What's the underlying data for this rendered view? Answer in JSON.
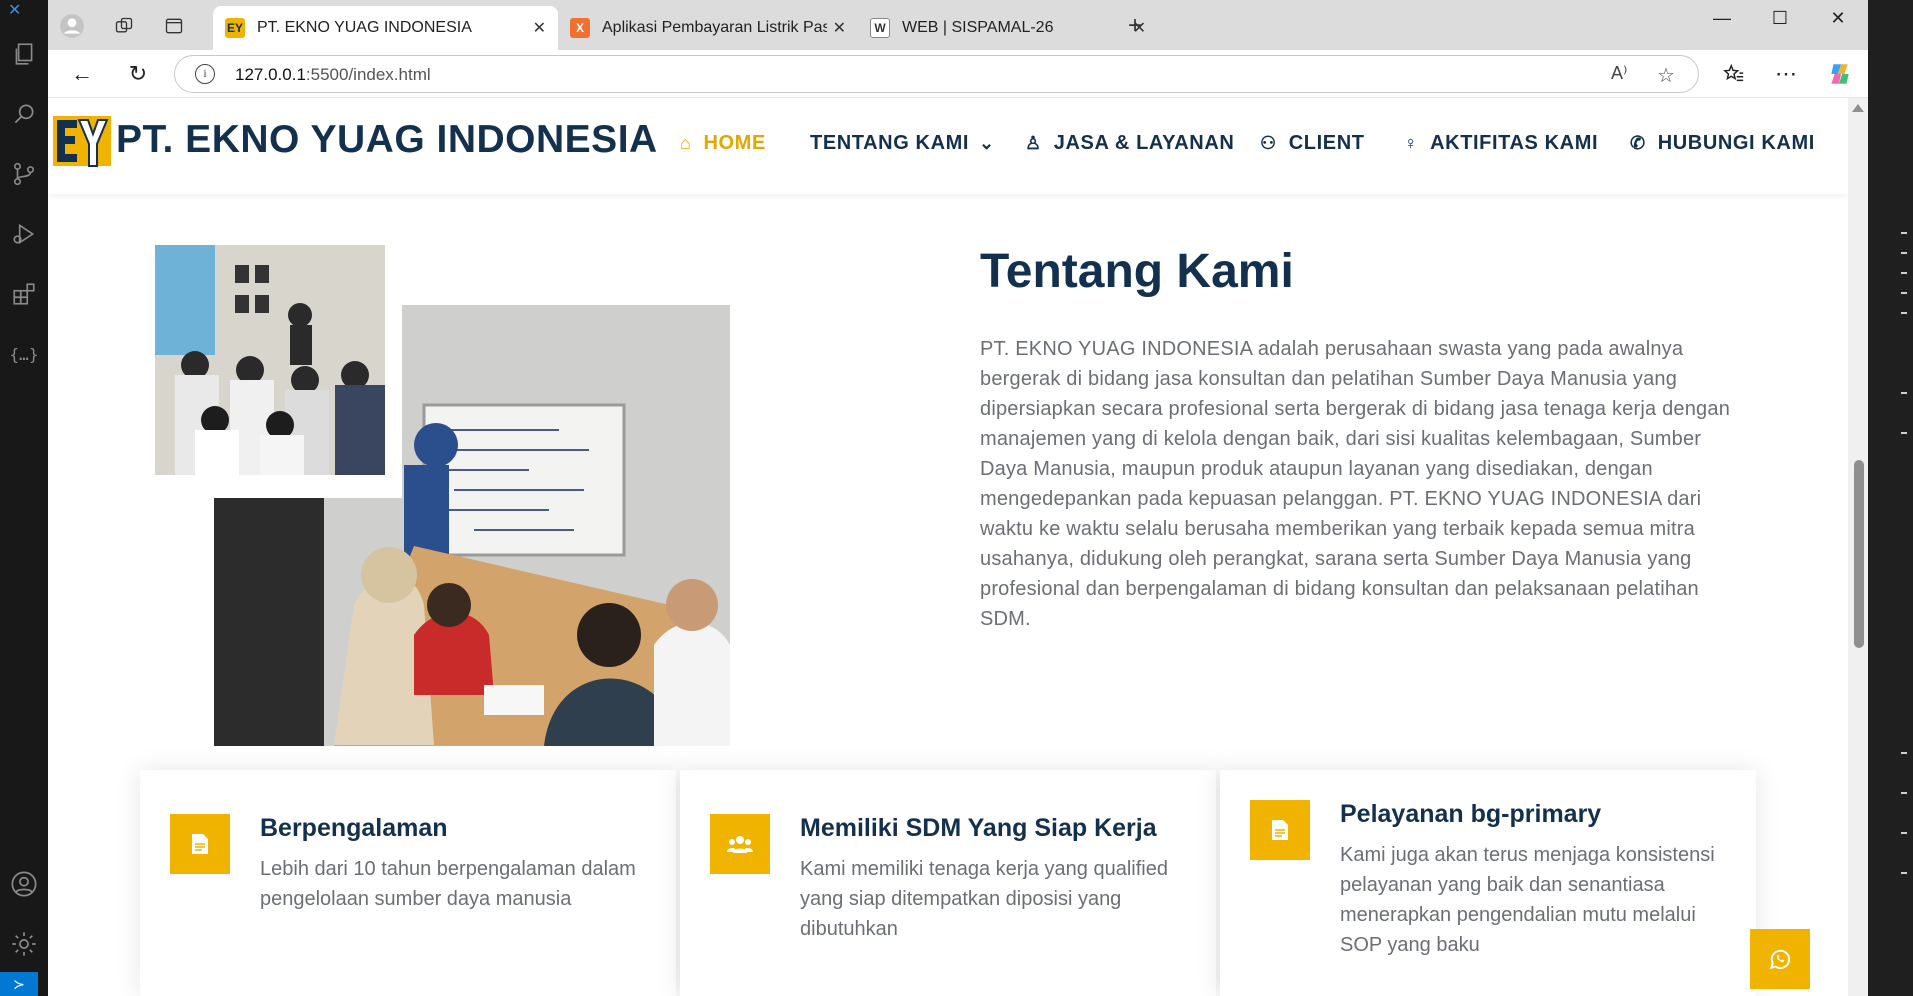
{
  "editor": {
    "activity_icons": [
      "explorer-icon",
      "search-icon",
      "source-control-icon",
      "run-debug-icon",
      "extensions-icon",
      "json-icon",
      "account-icon",
      "settings-icon"
    ]
  },
  "browser": {
    "tabs": [
      {
        "title": "PT. EKNO YUAG INDONESIA",
        "favicon": "EY",
        "active": true
      },
      {
        "title": "Aplikasi Pembayaran Listrik Pascab",
        "favicon": "X",
        "active": false
      },
      {
        "title": "WEB | SISPAMAL-26",
        "favicon": "W",
        "active": false
      }
    ],
    "url_host": "127.0.0.1",
    "url_rest": ":5500/index.html",
    "new_tab": "+"
  },
  "site": {
    "brand": "PT. EKNO YUAG INDONESIA",
    "logo_text": "EY",
    "nav": [
      {
        "label": "HOME",
        "icon": "home-icon",
        "glyph": "⌂"
      },
      {
        "label": "TENTANG KAMI",
        "icon": "chevron-down-icon",
        "glyph": "⌄"
      },
      {
        "label": "JASA & LAYANAN",
        "icon": "award-icon",
        "glyph": "♙"
      },
      {
        "label": "CLIENT",
        "icon": "users-icon",
        "glyph": "⚇"
      },
      {
        "label": "AKTIFITAS KAMI",
        "icon": "walking-icon",
        "glyph": "🚶"
      },
      {
        "label": "HUBUNGI KAMI",
        "icon": "phone-icon",
        "glyph": "✆"
      }
    ],
    "about": {
      "title": "Tentang Kami",
      "text": "PT. EKNO YUAG INDONESIA adalah perusahaan swasta yang pada awalnya bergerak di bidang jasa konsultan dan pelatihan Sumber Daya Manusia yang dipersiapkan secara profesional serta bergerak di bidang jasa tenaga kerja dengan manajemen yang di kelola dengan baik, dari sisi kualitas kelembagaan, Sumber Daya Manusia, maupun produk ataupun layanan yang disediakan, dengan mengedepankan pada kepuasan pelanggan. PT. EKNO YUAG INDONESIA dari waktu ke waktu selalu berusaha memberikan yang terbaik kepada semua mitra usahanya, didukung oleh perangkat, sarana serta Sumber Daya Manusia yang profesional dan berpengalaman di bidang konsultan dan pelaksanaan pelatihan SDM."
    },
    "features": [
      {
        "title": "Berpengalaman",
        "text": "Lebih dari 10 tahun berpengalaman dalam pengelolaan sumber daya manusia",
        "icon": "file-icon"
      },
      {
        "title": "Memiliki SDM Yang Siap Kerja",
        "text": "Kami memiliki tenaga kerja yang qualified yang siap ditempatkan diposisi yang dibutuhkan",
        "icon": "users-icon"
      },
      {
        "title": "Pelayanan bg-primary",
        "text": "Kami juga akan terus menjaga konsistensi pelayanan yang baik dan senantiasa menerapkan pengendalian mutu melalui SOP yang baku",
        "icon": "file-icon"
      }
    ],
    "accent_color": "#f0b400",
    "primary_color": "#14304f"
  }
}
